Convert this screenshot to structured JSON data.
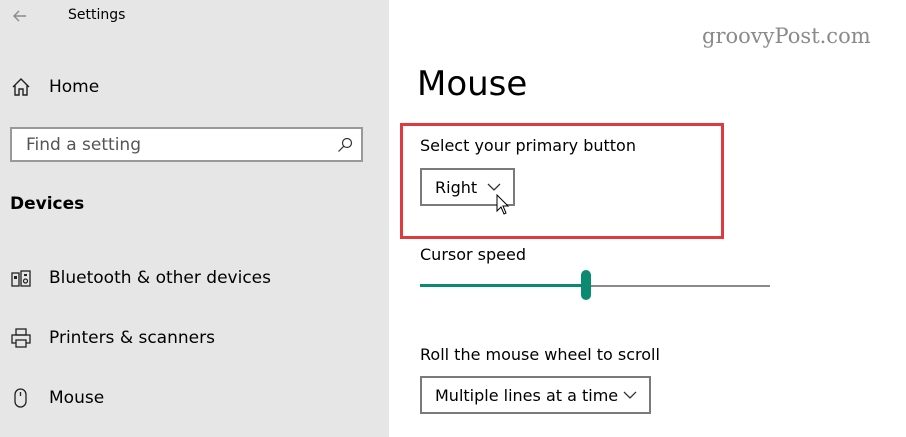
{
  "window": {
    "title": "Settings"
  },
  "sidebar": {
    "home_label": "Home",
    "search": {
      "placeholder": "Find a setting",
      "value": ""
    },
    "section_header": "Devices",
    "items": [
      {
        "label": "Bluetooth & other devices",
        "icon": "bluetooth-devices-icon"
      },
      {
        "label": "Printers & scanners",
        "icon": "printer-icon"
      },
      {
        "label": "Mouse",
        "icon": "mouse-icon"
      }
    ]
  },
  "main": {
    "watermark": "groovyPost.com",
    "title": "Mouse",
    "primary_button": {
      "label": "Select your primary button",
      "value": "Right"
    },
    "cursor_speed": {
      "label": "Cursor speed",
      "value_fraction": 0.475
    },
    "wheel_scroll": {
      "label": "Roll the mouse wheel to scroll",
      "value": "Multiple lines at a time"
    }
  },
  "colors": {
    "accent": "#0b8a72",
    "highlight_box": "#e0393f",
    "sidebar_bg": "#e6e6e6",
    "main_bg": "#ffffff"
  }
}
